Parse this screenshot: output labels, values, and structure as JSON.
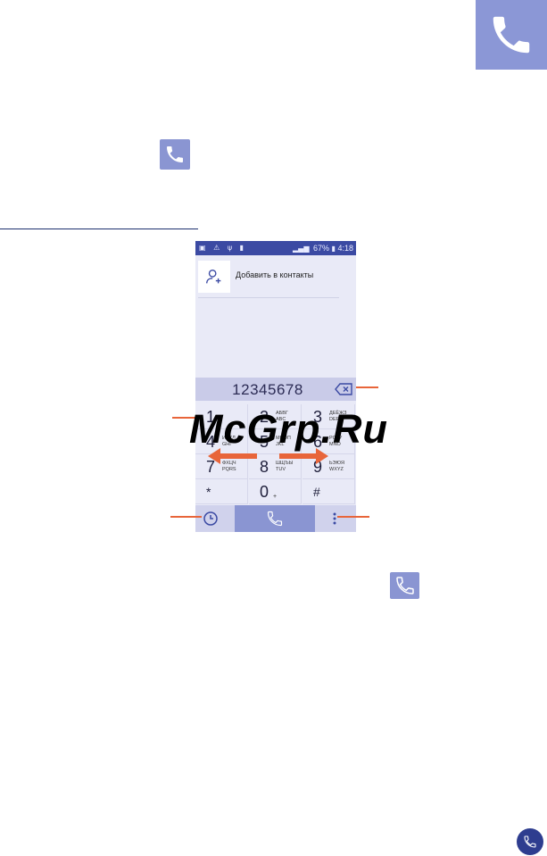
{
  "statusbar": {
    "battery_percent": "67%",
    "time": "4:18"
  },
  "contact": {
    "add_label": "Добавить в контакты"
  },
  "dialer": {
    "number": "12345678",
    "keys": [
      {
        "digit": "1",
        "letters": "",
        "sub": ""
      },
      {
        "digit": "2",
        "letters": "АБВГ\nABC",
        "sub": ""
      },
      {
        "digit": "3",
        "letters": "ДЕЁЖЗ\nDEF",
        "sub": ""
      },
      {
        "digit": "4",
        "letters": "ИЙКЛ\nGHI",
        "sub": ""
      },
      {
        "digit": "5",
        "letters": "МНОП\nJKL",
        "sub": ""
      },
      {
        "digit": "6",
        "letters": "РСТУ\nMNO",
        "sub": ""
      },
      {
        "digit": "7",
        "letters": "ФХЦЧ\nPQRS",
        "sub": ""
      },
      {
        "digit": "8",
        "letters": "ШЩЪЫ\nTUV",
        "sub": ""
      },
      {
        "digit": "9",
        "letters": "ЬЭЮЯ\nWXYZ",
        "sub": ""
      },
      {
        "digit": "*",
        "letters": "",
        "sub": ""
      },
      {
        "digit": "0",
        "letters": "",
        "sub": "+"
      },
      {
        "digit": "#",
        "letters": "",
        "sub": ""
      }
    ]
  },
  "watermark": "McGrp.Ru",
  "colors": {
    "accent": "#8a95d2",
    "statusbar": "#3b4aa3",
    "callout": "#e8653a",
    "rule": "#1c2f6e"
  },
  "icons": {
    "header_badge": "phone-icon",
    "inline_1": "phone-icon",
    "inline_2": "phone-icon",
    "corner": "phone-icon"
  }
}
